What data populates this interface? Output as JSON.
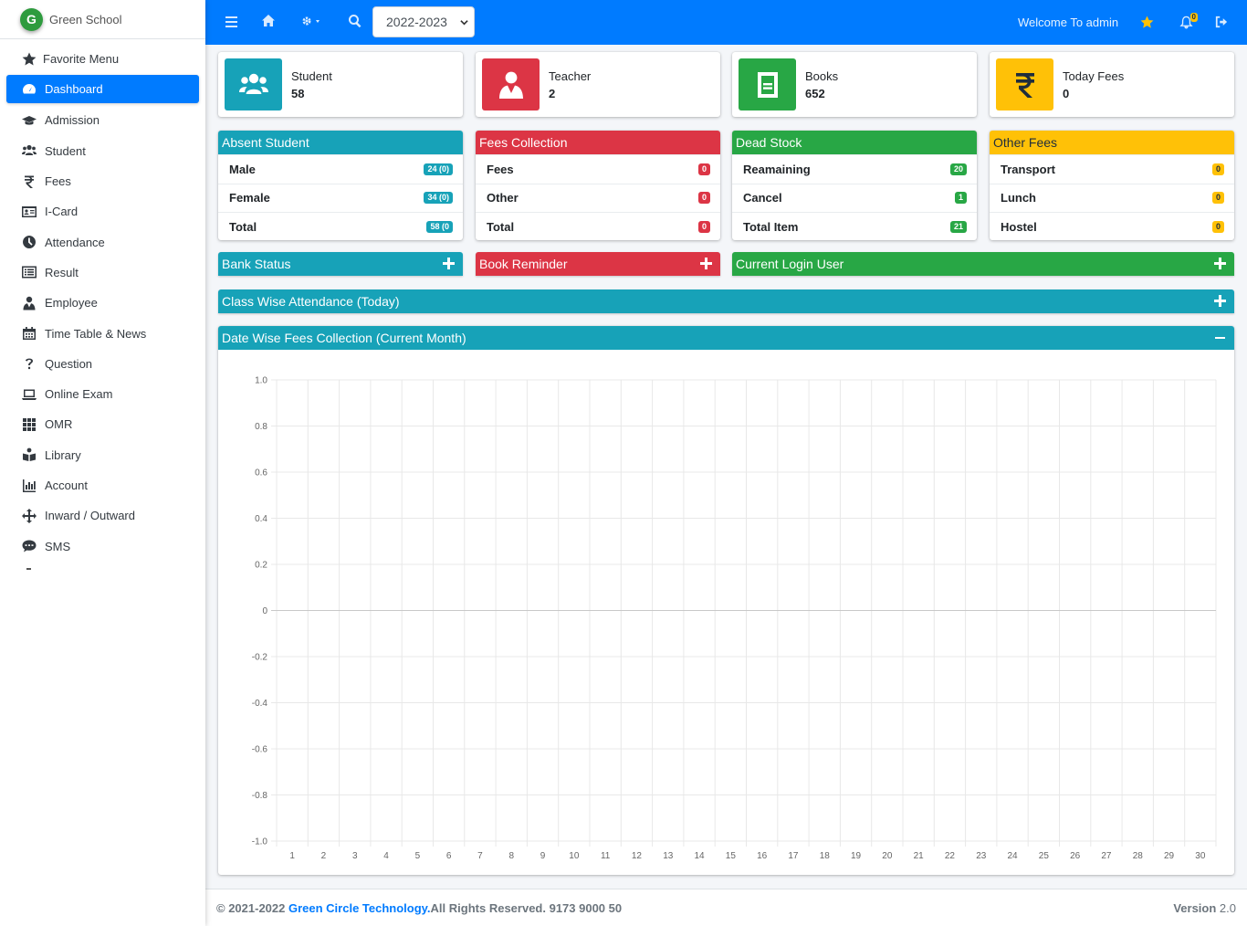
{
  "brand": {
    "logo_letter": "G",
    "name": "Green School"
  },
  "sidebar": {
    "items": [
      {
        "label": "Favorite Menu",
        "icon": "star-icon"
      },
      {
        "label": "Dashboard",
        "icon": "tachometer-icon",
        "active": true
      },
      {
        "label": "Admission",
        "icon": "graduation-cap-icon"
      },
      {
        "label": "Student",
        "icon": "users-icon"
      },
      {
        "label": "Fees",
        "icon": "rupee-icon"
      },
      {
        "label": "I-Card",
        "icon": "id-card-icon"
      },
      {
        "label": "Attendance",
        "icon": "clock-icon"
      },
      {
        "label": "Result",
        "icon": "list-icon"
      },
      {
        "label": "Employee",
        "icon": "user-tie-icon"
      },
      {
        "label": "Time Table & News",
        "icon": "calendar-icon"
      },
      {
        "label": "Question",
        "icon": "question-icon"
      },
      {
        "label": "Online Exam",
        "icon": "laptop-icon"
      },
      {
        "label": "OMR",
        "icon": "grid-icon"
      },
      {
        "label": "Library",
        "icon": "book-reader-icon"
      },
      {
        "label": "Account",
        "icon": "bar-chart-icon"
      },
      {
        "label": "Inward / Outward",
        "icon": "arrows-icon"
      },
      {
        "label": "SMS",
        "icon": "sms-icon"
      }
    ]
  },
  "topbar": {
    "year": "2022-2023",
    "welcome": "Welcome To admin",
    "notification_count": "0"
  },
  "info_boxes": [
    {
      "label": "Student",
      "value": "58",
      "color": "#17a2b8",
      "icon": "users-icon"
    },
    {
      "label": "Teacher",
      "value": "2",
      "color": "#dc3545",
      "icon": "user-tie-icon"
    },
    {
      "label": "Books",
      "value": "652",
      "color": "#28a745",
      "icon": "book-icon"
    },
    {
      "label": "Today Fees",
      "value": "0",
      "color": "#ffc107",
      "icon": "rupee-icon"
    }
  ],
  "stat_cards": [
    {
      "title": "Absent Student",
      "color": "#17a2b8",
      "rows": [
        {
          "label": "Male",
          "badge": "24 (0)"
        },
        {
          "label": "Female",
          "badge": "34 (0)"
        },
        {
          "label": "Total",
          "badge": "58 (0"
        }
      ]
    },
    {
      "title": "Fees Collection",
      "color": "#dc3545",
      "rows": [
        {
          "label": "Fees",
          "badge": "0"
        },
        {
          "label": "Other",
          "badge": "0"
        },
        {
          "label": "Total",
          "badge": "0"
        }
      ]
    },
    {
      "title": "Dead Stock",
      "color": "#28a745",
      "rows": [
        {
          "label": "Reamaining",
          "badge": "20"
        },
        {
          "label": "Cancel",
          "badge": "1"
        },
        {
          "label": "Total Item",
          "badge": "21"
        }
      ]
    },
    {
      "title": "Other Fees",
      "color": "#ffc107",
      "rows": [
        {
          "label": "Transport",
          "badge": "0"
        },
        {
          "label": "Lunch",
          "badge": "0"
        },
        {
          "label": "Hostel",
          "badge": "0"
        }
      ]
    }
  ],
  "collapsed_panels": {
    "bank_status": "Bank Status",
    "book_reminder": "Book Reminder",
    "current_login_user": "Current Login User",
    "class_attendance": "Class Wise Attendance (Today)"
  },
  "chart_panel": {
    "title": "Date Wise Fees Collection (Current Month)"
  },
  "chart_data": {
    "type": "line",
    "title": "",
    "x": [
      1,
      2,
      3,
      4,
      5,
      6,
      7,
      8,
      9,
      10,
      11,
      12,
      13,
      14,
      15,
      16,
      17,
      18,
      19,
      20,
      21,
      22,
      23,
      24,
      25,
      26,
      27,
      28,
      29,
      30
    ],
    "y_ticks": [
      "1.0",
      "0.8",
      "0.6",
      "0.4",
      "0.2",
      "0",
      "-0.2",
      "-0.4",
      "-0.6",
      "-0.8",
      "-1.0"
    ],
    "ylim": [
      -1.0,
      1.0
    ],
    "series": [],
    "grid": true
  },
  "footer": {
    "copyright": "© 2021-2022",
    "company": "Green Circle Technology.",
    "rights": "All Rights Reserved. 9173 9000 50",
    "version_label": "Version",
    "version": "2.0"
  }
}
